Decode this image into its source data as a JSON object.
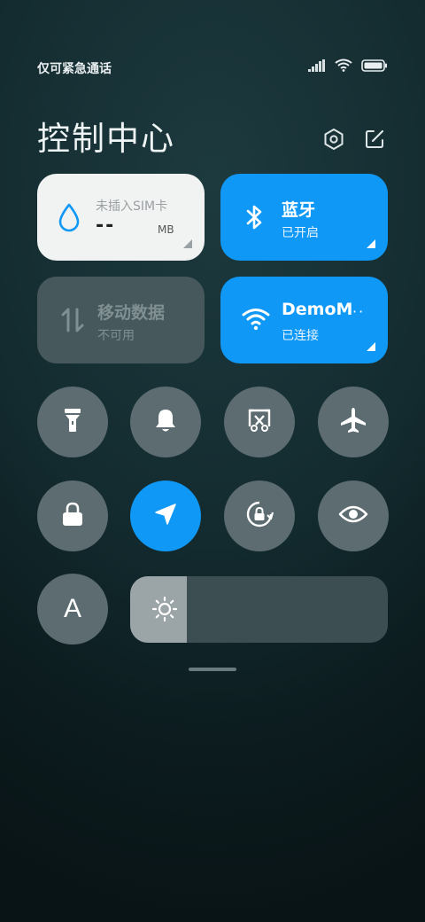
{
  "status_bar": {
    "carrier_text": "仅可紧急通话",
    "icons": [
      "signal-icon",
      "wifi-icon",
      "battery-icon"
    ]
  },
  "header": {
    "title": "控制中心",
    "settings_icon": "gear-icon",
    "edit_icon": "edit-icon"
  },
  "tiles": {
    "data_usage": {
      "label": "未插入SIM卡",
      "value": "--",
      "unit": "MB",
      "icon": "water-drop-icon"
    },
    "bluetooth": {
      "name": "蓝牙",
      "state": "已开启",
      "icon": "bluetooth-icon",
      "active": true
    },
    "mobile_data": {
      "name": "移动数据",
      "state": "不可用",
      "icon": "mobile-data-icon",
      "active": false
    },
    "wifi": {
      "name": "DemoM",
      "suffix": "··",
      "state": "已连接",
      "icon": "wifi-icon",
      "active": true
    }
  },
  "toggles": [
    {
      "name": "flashlight",
      "icon": "flashlight-icon",
      "active": false
    },
    {
      "name": "ringer",
      "icon": "bell-icon",
      "active": false
    },
    {
      "name": "screenshot",
      "icon": "scissors-icon",
      "active": false
    },
    {
      "name": "airplane-mode",
      "icon": "airplane-icon",
      "active": false
    },
    {
      "name": "lock-screen",
      "icon": "lock-icon",
      "active": false
    },
    {
      "name": "location",
      "icon": "location-arrow-icon",
      "active": true
    },
    {
      "name": "rotation-lock",
      "icon": "rotation-lock-icon",
      "active": false
    },
    {
      "name": "reading-mode",
      "icon": "eye-icon",
      "active": false
    },
    {
      "name": "auto-brightness",
      "icon": "letter-a-icon",
      "active": false,
      "glyph": "A"
    }
  ],
  "brightness": {
    "level": 0.22,
    "icon": "sun-icon"
  },
  "colors": {
    "accent": "#0f98f5",
    "tile_inactive": "#46585c",
    "round_inactive": "#5c6c70"
  }
}
